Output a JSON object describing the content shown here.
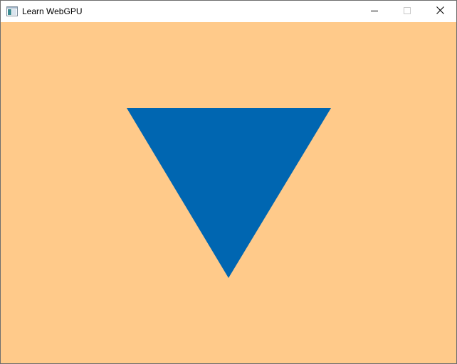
{
  "window": {
    "title": "Learn WebGPU"
  },
  "icons": {
    "app": "app-window-icon",
    "minimize": "minimize-icon",
    "maximize": "maximize-icon",
    "close": "close-icon"
  },
  "canvas": {
    "clear_color": "#ffca8a",
    "shape": "triangle",
    "shape_color": "#0066b1",
    "orientation": "pointing-down"
  }
}
